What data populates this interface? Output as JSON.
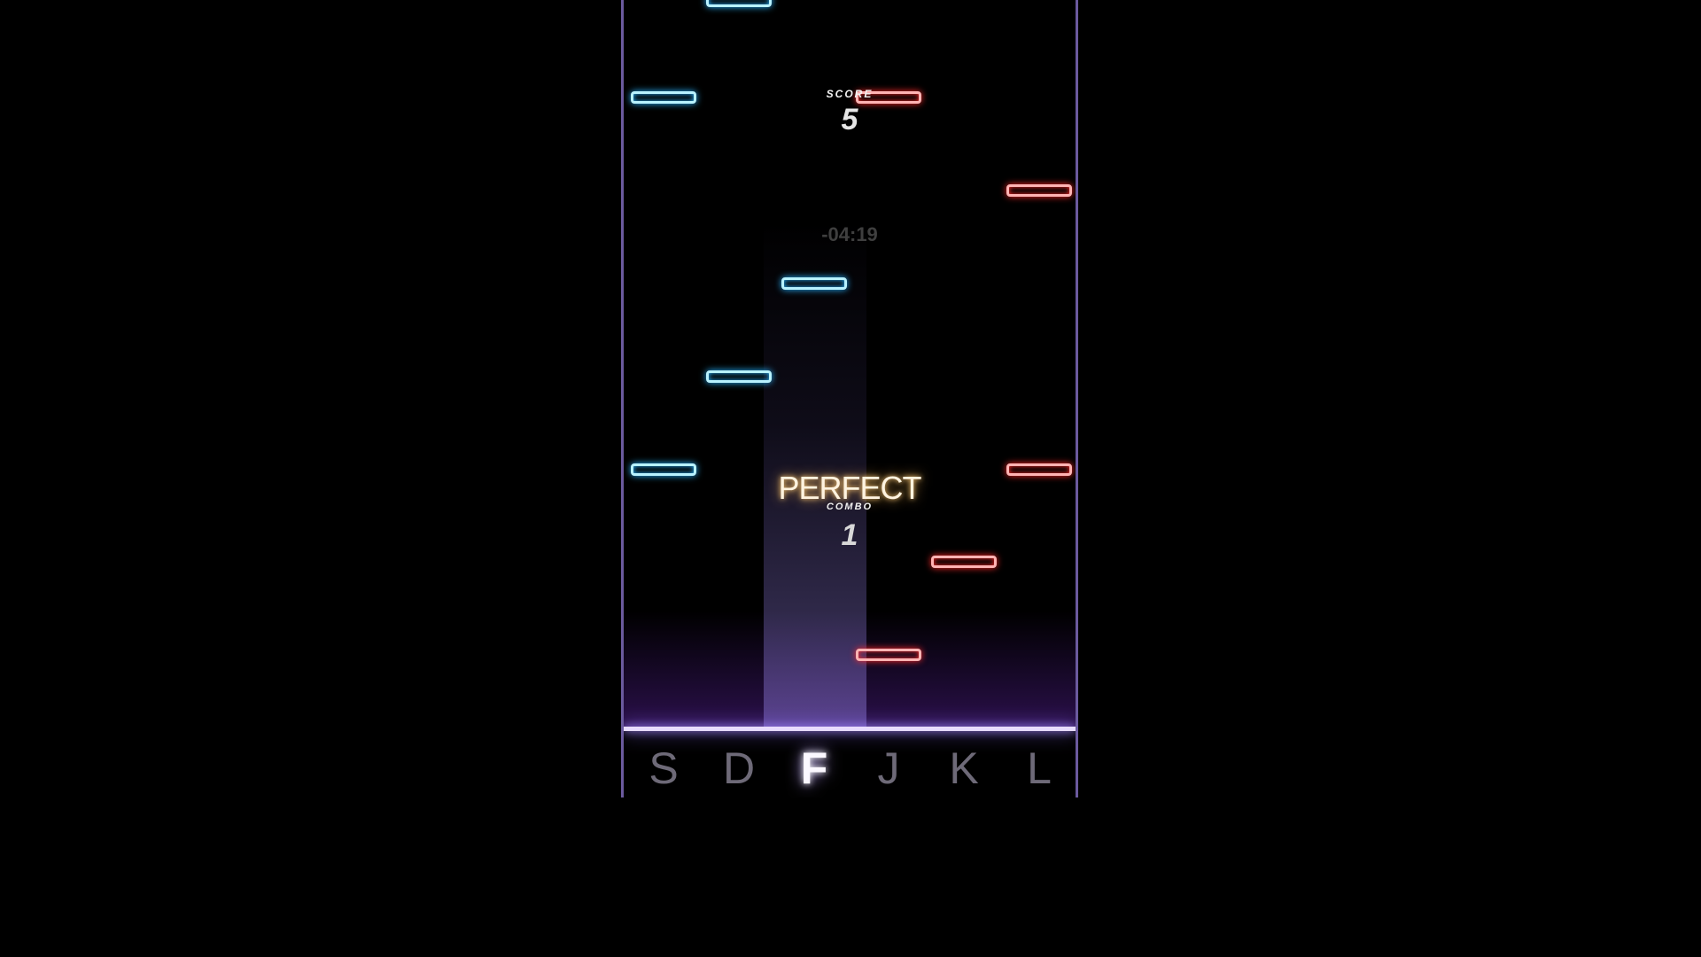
{
  "hud": {
    "score_label": "SCORE",
    "score_value": "5",
    "timer": "-04:19",
    "judgement": "PERFECT",
    "combo_label": "COMBO",
    "combo_value": "1"
  },
  "keys": [
    {
      "label": "S",
      "active": false
    },
    {
      "label": "D",
      "active": false
    },
    {
      "label": "F",
      "active": true
    },
    {
      "label": "J",
      "active": false
    },
    {
      "label": "K",
      "active": false
    },
    {
      "label": "L",
      "active": false
    }
  ],
  "note_colors": {
    "blue": "#2ab4ff",
    "red": "#ff2a2a"
  }
}
